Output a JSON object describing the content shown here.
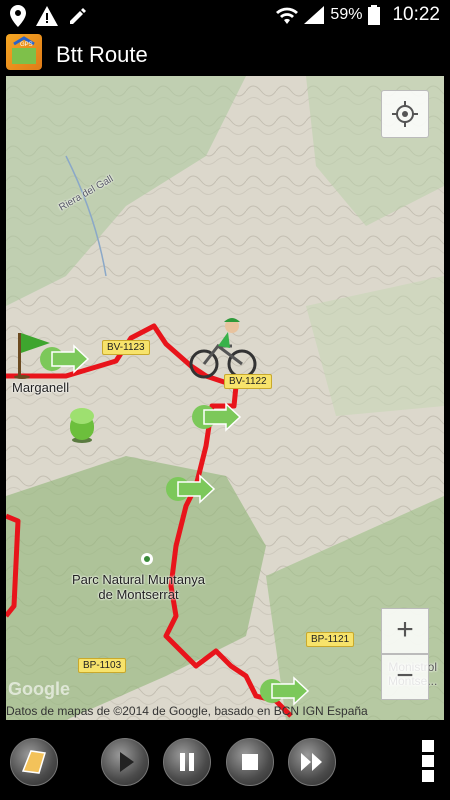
{
  "status_bar": {
    "battery_percent": "59%",
    "time": "10:22",
    "left_icons": [
      "location-pin-icon",
      "warning-icon",
      "edit-icon"
    ],
    "right_icons": [
      "wifi-icon",
      "signal-icon",
      "battery-icon"
    ]
  },
  "app_bar": {
    "title": "Btt Route",
    "app_icon": "gps-map-icon"
  },
  "map": {
    "places": {
      "marganell": "Marganell",
      "park": "Parc Natural Muntanya\nde Montserrat",
      "monistrol": "Monistrol\nMontse..."
    },
    "roads": {
      "bv1123": "BV-1123",
      "bv1122": "BV-1122",
      "bp1121": "BP-1121",
      "bp1103": "BP-1103"
    },
    "river_label": "Riera del Gall",
    "watermark": "Google",
    "attribution": "Datos de mapas de ©2014 de Google, basado en BCN IGN España",
    "route_color": "#e8141b",
    "controls": {
      "locate": "crosshair-icon",
      "zoom_in": "+",
      "zoom_out": "−"
    }
  },
  "bottom_bar": {
    "buttons": [
      "map-layer-icon",
      "play-icon",
      "pause-icon",
      "stop-icon",
      "fast-forward-icon",
      "overflow-menu-icon"
    ]
  }
}
